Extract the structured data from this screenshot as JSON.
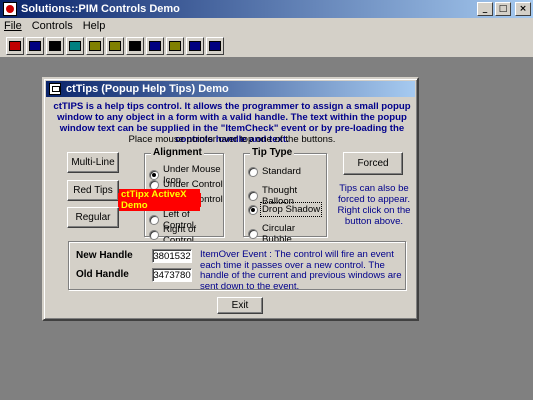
{
  "app": {
    "title": "Solutions::PIM Controls Demo",
    "window_buttons": [
      "_",
      "□",
      "×"
    ]
  },
  "menu": {
    "items": [
      {
        "label": "File",
        "u": "F"
      },
      {
        "label": "Controls",
        "u": "C"
      },
      {
        "label": "Help",
        "u": "H"
      }
    ]
  },
  "toolbar": {
    "buttons": [
      {
        "icon": "app-icon",
        "color": "#c00000"
      },
      {
        "icon": "grid-icon",
        "color": "#000080"
      },
      {
        "icon": "columns-icon",
        "color": "#000000"
      },
      {
        "icon": "table-icon",
        "color": "#008080"
      },
      {
        "icon": "book-icon",
        "color": "#808000"
      },
      {
        "icon": "book-icon",
        "color": "#808000"
      },
      {
        "icon": "barcode-icon",
        "color": "#000000"
      },
      {
        "icon": "chart-icon",
        "color": "#000080"
      },
      {
        "icon": "label-icon",
        "color": "#808000"
      },
      {
        "icon": "window-icon",
        "color": "#000080"
      },
      {
        "icon": "window-icon",
        "color": "#000080"
      }
    ]
  },
  "dialog": {
    "title": "ctTips (Popup Help Tips) Demo",
    "intro": "ctTIPS is a help tips control. It allows the programmer to assign a small popup window to any object in a form with a valid handle. The text within the popup window text can be supplied in the \"ItemCheck\" event or by pre-loading the controls handle and text.",
    "hint": "Place mouse pointer over top one of the buttons.",
    "buttons": {
      "multiline": "Multi-Line",
      "redtips": "Red Tips",
      "regular": "Regular",
      "forced": "Forced",
      "exit": "Exit"
    },
    "alignment": {
      "label": "Alignment",
      "options": [
        "Under Mouse Icon",
        "Under Control",
        "Top of Control",
        "Left of Control",
        "Right of Control"
      ],
      "selected": 0
    },
    "tip_type": {
      "label": "Tip Type",
      "options": [
        "Standard",
        "Thought Balloon",
        "Drop Shadow",
        "Circular Bubble"
      ],
      "selected": 2
    },
    "forced_note": "Tips can also be forced to appear. Right click on the button above.",
    "popup_tip": "ctTipx ActiveX Demo",
    "handles": {
      "new_label": "New Handle",
      "new_value": "3801532",
      "old_label": "Old Handle",
      "old_value": "3473780",
      "event_text": "ItemOver Event : The control will fire an event each time it passes over a new control. The handle of the current and previous windows are sent down to the event."
    }
  }
}
